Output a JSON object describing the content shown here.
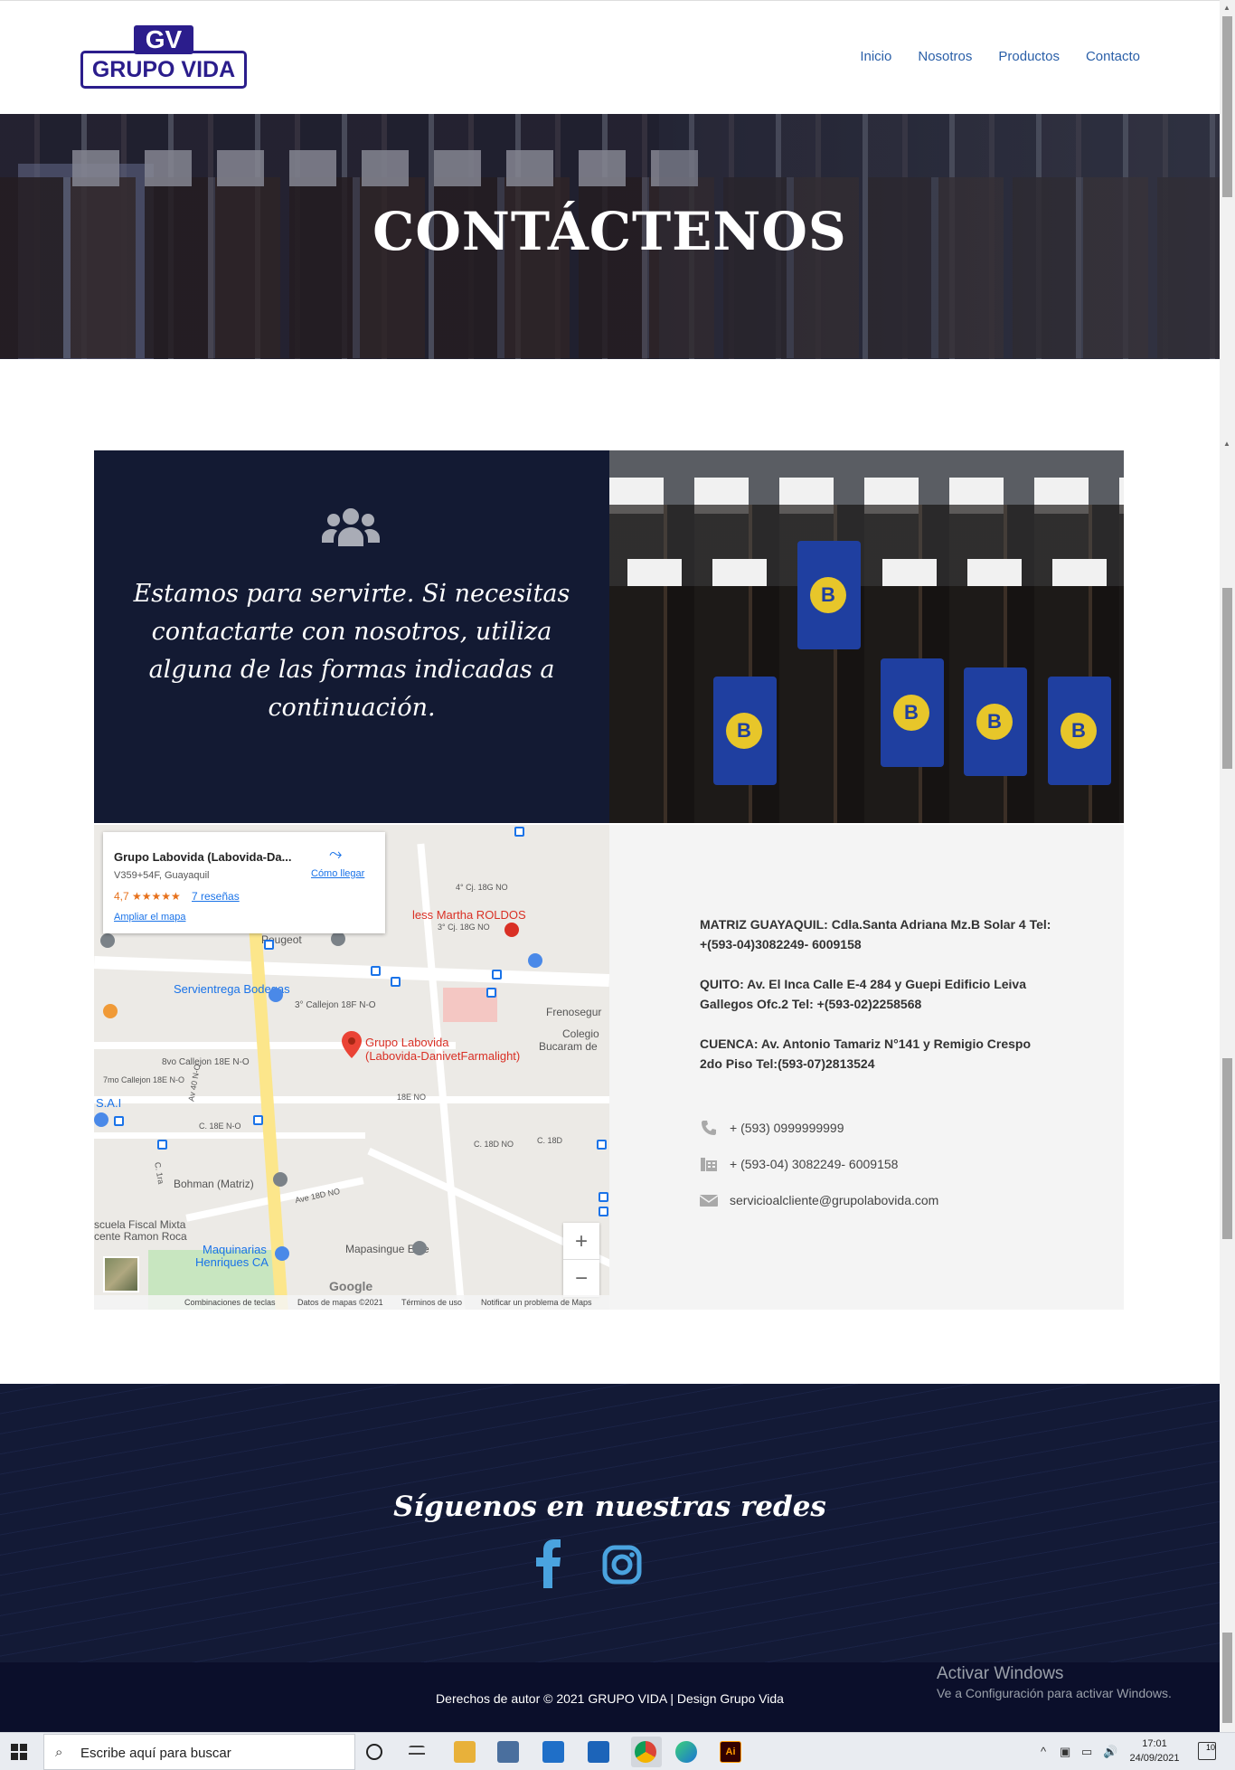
{
  "header": {
    "logo_top": "GV",
    "logo_bottom": "GRUPO VIDA",
    "nav": [
      "Inicio",
      "Nosotros",
      "Productos",
      "Contacto"
    ]
  },
  "hero": {
    "title": "CONTÁCTENOS"
  },
  "intro": {
    "icon": "users-icon",
    "text": "Estamos para servirte. Si necesitas contactarte con nosotros, utiliza alguna de las formas indicadas a continuación."
  },
  "map": {
    "card": {
      "name": "Grupo Labovida (Labovida-Da...",
      "address": "V359+54F, Guayaquil",
      "rating": "4,7 ★★★★★",
      "reviews": "7 reseñas",
      "expand": "Ampliar el mapa",
      "directions": "Cómo llegar"
    },
    "labels": {
      "hospital": "less Martha ROLDOS",
      "servientrega": "Servientrega Bodegas",
      "peugeot": "Peugeot",
      "labovida_1": "Grupo Labovida",
      "labovida_2": "(Labovida-DanivetFarmalight)",
      "frenosegu": "Frenosegur",
      "colegio_1": "Colegio",
      "colegio_2": "Bucaram de",
      "sai": "S.A.I",
      "bohman": "Bohman (Matriz)",
      "escuela_1": "scuela Fiscal Mixta",
      "escuela_2": "cente Ramon Roca",
      "maquinarias_1": "Maquinarias",
      "maquinarias_2": "Henriques CA",
      "mapasingue": "Mapasingue Este",
      "callejon3": "3° Callejon 18F N-O",
      "callejon8": "8vo Callejon 18E N-O",
      "callejon7": "7mo Callejon 18E N-O",
      "c18eno": "C. 18E N-O",
      "n18eno": "18E NO",
      "c18dno": "C. 18D NO",
      "c18d": "C. 18D",
      "ave18dno": "Ave 18D NO",
      "cj18gno": "4° Cj. 18G NO",
      "cj18gno3": "3° Cj. 18G NO",
      "av40": "Av 40 N-O",
      "c1ra": "C. 1ra"
    },
    "zoom_in": "+",
    "zoom_out": "−",
    "google": "Google",
    "attribution": [
      "Combinaciones de teclas",
      "Datos de mapas ©2021",
      "Términos de uso",
      "Notificar un problema de Maps"
    ]
  },
  "contact": {
    "addresses": [
      "MATRIZ GUAYAQUIL: Cdla.Santa Adriana Mz.B Solar 4 Tel: +(593-04)3082249- 6009158",
      "QUITO: Av. El Inca Calle E-4 284 y Guepi Edificio Leiva Gallegos Ofc.2 Tel: +(593-02)2258568",
      "CUENCA: Av. Antonio Tamariz N°141 y Remigio Crespo 2do Piso Tel:(593-07)2813524"
    ],
    "phone": "+ (593) 0999999999",
    "fax": "+ (593-04) 3082249- 6009158",
    "email": "servicioalcliente@grupolabovida.com"
  },
  "footer": {
    "title": "Síguenos en nuestras redes",
    "copyright": "Derechos de autor © 2021 GRUPO VIDA | Design Grupo Vida",
    "social_color": "#4aa3df"
  },
  "windows": {
    "activate_title": "Activar Windows",
    "activate_sub": "Ve a Configuración para activar Windows.",
    "search_placeholder": "Escribe aquí para buscar",
    "time": "17:01",
    "date": "24/09/2021",
    "notif_count": "10"
  }
}
